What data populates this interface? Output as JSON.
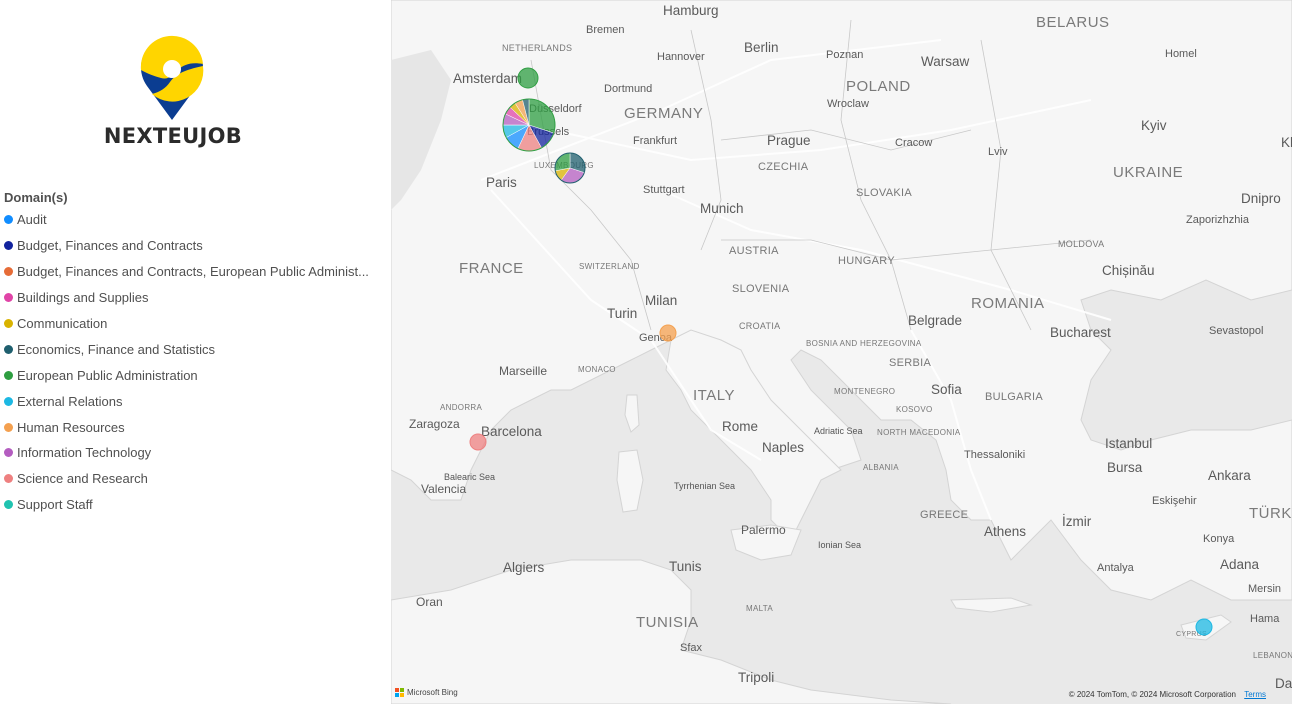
{
  "logo": {
    "text": "NEXTEUJOB"
  },
  "legend": {
    "title": "Domain(s)",
    "items": [
      {
        "label": "Audit",
        "color": "#118DFF"
      },
      {
        "label": "Budget, Finances and Contracts",
        "color": "#12239E"
      },
      {
        "label": "Budget, Finances and Contracts, European Public Administ...",
        "color": "#E66C37"
      },
      {
        "label": "Buildings and Supplies",
        "color": "#E044A7"
      },
      {
        "label": "Communication",
        "color": "#D9B300"
      },
      {
        "label": "Economics, Finance and Statistics",
        "color": "#1F5F6E"
      },
      {
        "label": "European Public Administration",
        "color": "#2E9E41"
      },
      {
        "label": "External Relations",
        "color": "#1CB8E3"
      },
      {
        "label": "Human Resources",
        "color": "#F4A04F"
      },
      {
        "label": "Information Technology",
        "color": "#B45DC0"
      },
      {
        "label": "Science and Research",
        "color": "#EE8080"
      },
      {
        "label": "Support Staff",
        "color": "#20C3B0"
      }
    ]
  },
  "map": {
    "labels": {
      "countries": [
        "BELARUS",
        "POLAND",
        "GERMANY",
        "UKRAINE",
        "CZECHIA",
        "SLOVAKIA",
        "FRANCE",
        "AUSTRIA",
        "HUNGARY",
        "ROMANIA",
        "MOLDOVA",
        "SLOVENIA",
        "CROATIA",
        "SERBIA",
        "ITALY",
        "BULGARIA",
        "GREECE",
        "TÜRKIYE",
        "TUNISIA",
        "NETHERLANDS",
        "SWITZERLAND",
        "LUXEMBOURG",
        "BOSNIA AND HERZEGOVINA",
        "MONTENEGRO",
        "KOSOVO",
        "NORTH MACEDONIA",
        "ALBANIA",
        "ANDORRA",
        "MONACO",
        "MALTA",
        "LEBANON",
        "CYPRUS"
      ],
      "cities": [
        "Hamburg",
        "Bremen",
        "Berlin",
        "Hannover",
        "Poznan",
        "Warsaw",
        "Homel",
        "Amsterdam",
        "Dortmund",
        "Wroclaw",
        "Düsseldorf",
        "Kyiv",
        "Frankfurt",
        "Prague",
        "Cracow",
        "Lviv",
        "Paris",
        "Stuttgart",
        "Munich",
        "Zaporizhzhia",
        "Dnipro",
        "Chișinău",
        "Milan",
        "Turin",
        "Genoa",
        "Belgrade",
        "Bucharest",
        "Sevastopol",
        "Marseille",
        "Sofia",
        "Zaragoza",
        "Barcelona",
        "Rome",
        "Naples",
        "Istanbul",
        "Bursa",
        "Ankara",
        "Eskişehir",
        "Thessaloniki",
        "Valencia",
        "Palermo",
        "Athens",
        "İzmir",
        "Konya",
        "Adana",
        "Antalya",
        "Mersin",
        "Hama",
        "Algiers",
        "Tunis",
        "Oran",
        "Sfax",
        "Tripoli",
        "Kharkiv",
        "Brussels",
        "Damascus"
      ],
      "seas": [
        "Balearic Sea",
        "Tyrrhenian Sea",
        "Ionian Sea",
        "Adriatic Sea"
      ]
    },
    "bubbles": [
      {
        "place": "Amsterdam",
        "slices": [
          {
            "domain": "European Public Administration",
            "share": 1
          }
        ]
      },
      {
        "place": "Brussels",
        "slices": [
          {
            "domain": "European Public Administration",
            "share": 0.3
          },
          {
            "domain": "Budget, Finances and Contracts",
            "share": 0.12
          },
          {
            "domain": "Science and Research",
            "share": 0.15
          },
          {
            "domain": "Audit",
            "share": 0.1
          },
          {
            "domain": "External Relations",
            "share": 0.08
          },
          {
            "domain": "Information Technology",
            "share": 0.07
          },
          {
            "domain": "Buildings and Supplies",
            "share": 0.05
          },
          {
            "domain": "Communication",
            "share": 0.04
          },
          {
            "domain": "Human Resources",
            "share": 0.05
          },
          {
            "domain": "Economics, Finance and Statistics",
            "share": 0.04
          }
        ]
      },
      {
        "place": "Luxembourg",
        "slices": [
          {
            "domain": "Economics, Finance and Statistics",
            "share": 0.3
          },
          {
            "domain": "Information Technology",
            "share": 0.3
          },
          {
            "domain": "Communication",
            "share": 0.12
          },
          {
            "domain": "European Public Administration",
            "share": 0.28
          }
        ]
      },
      {
        "place": "Genoa",
        "slices": [
          {
            "domain": "Human Resources",
            "share": 1
          }
        ]
      },
      {
        "place": "Barcelona",
        "slices": [
          {
            "domain": "Science and Research",
            "share": 1
          }
        ]
      },
      {
        "place": "Cyprus",
        "slices": [
          {
            "domain": "External Relations",
            "share": 1
          }
        ]
      }
    ],
    "bing_label": "Microsoft Bing",
    "copyright": "© 2024 TomTom, © 2024 Microsoft Corporation",
    "terms": "Terms"
  }
}
